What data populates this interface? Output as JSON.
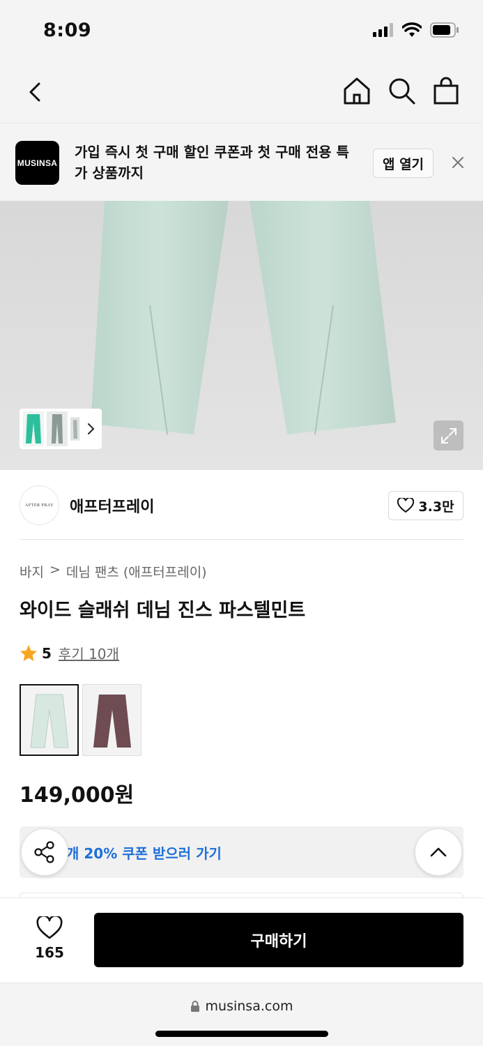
{
  "status_bar": {
    "time": "8:09"
  },
  "nav": {
    "icons": [
      "back-icon",
      "home-icon",
      "search-icon",
      "bag-icon"
    ]
  },
  "banner": {
    "logo_text": "MUSINSA",
    "message": "가입 즉시 첫 구매 할인 쿠폰과 첫 구매 전용 특가 상품까지",
    "open_label": "앱 열기"
  },
  "hero": {
    "image": "wide-jeans-pastel-mint"
  },
  "brand": {
    "logo_text": "AFTER PRAY",
    "name": "애프터프레이",
    "likes": "3.3만"
  },
  "breadcrumb": {
    "category": "바지",
    "separator": ">",
    "subcategory": "데님 팬츠 (애프터프레이)"
  },
  "product": {
    "title": "와이드 슬래쉬 데님 진스 파스텔민트",
    "rating": "5",
    "reviews": "후기 10개",
    "price": "149,000원",
    "variants": [
      "pastel-mint",
      "brown"
    ]
  },
  "coupon": {
    "text": "개 20% 쿠폰 받으러 가기",
    "color": "#1e6fd9"
  },
  "bottom": {
    "wish_count": "165",
    "buy_label": "구매하기"
  },
  "browser": {
    "url": "musinsa.com"
  }
}
